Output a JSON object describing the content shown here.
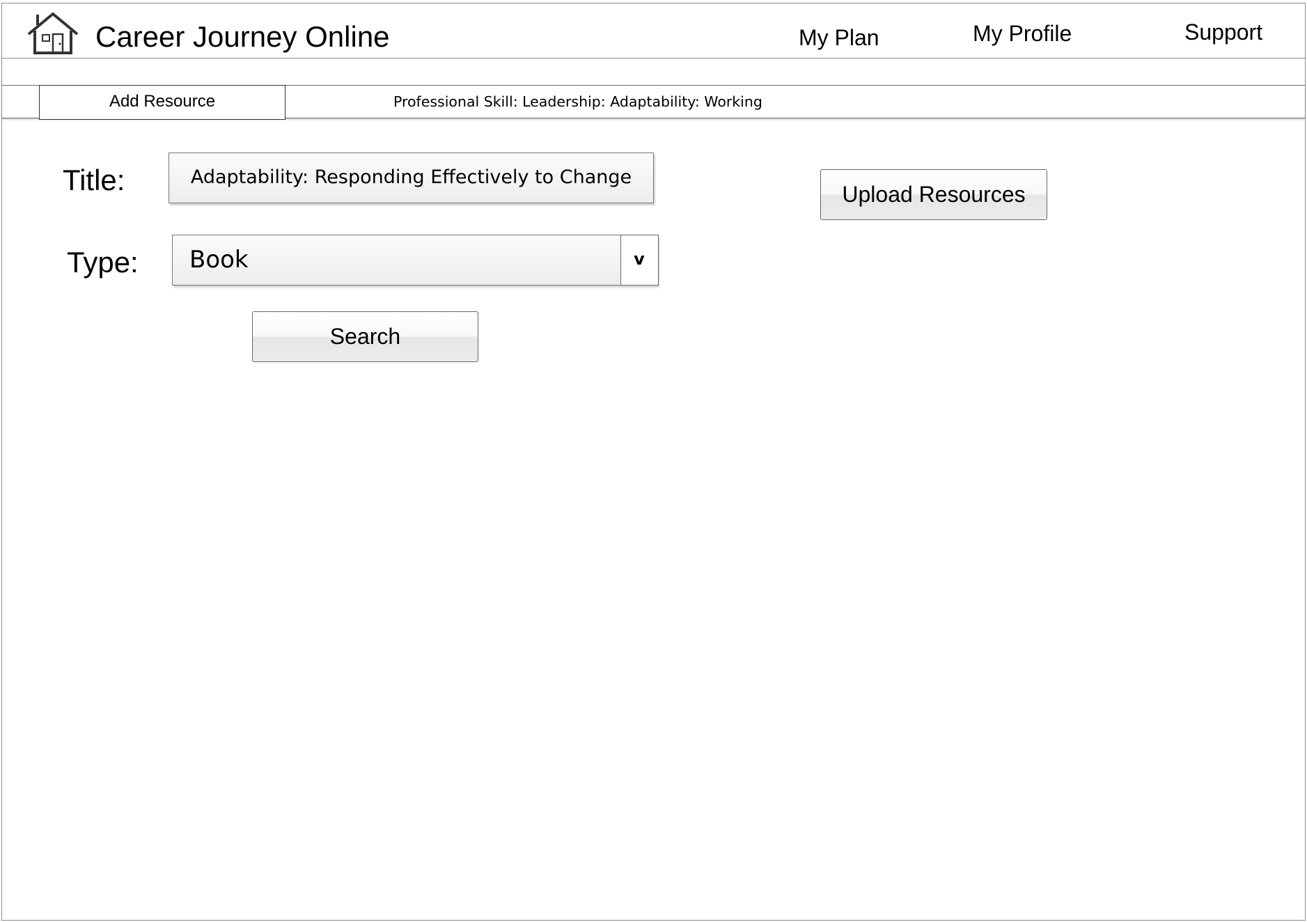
{
  "header": {
    "app_title": "Career Journey Online",
    "nav": {
      "my_plan": "My Plan",
      "my_profile": "My Profile",
      "support": "Support"
    }
  },
  "subbar": {
    "active_tab": "Add Resource",
    "breadcrumb": "Professional Skill: Leadership: Adaptability: Working"
  },
  "form": {
    "title_label": "Title:",
    "title_value": "Adaptability: Responding Effectively to Change",
    "type_label": "Type:",
    "type_value": "Book",
    "dropdown_glyph": "v",
    "search_button": "Search",
    "upload_button": "Upload Resources"
  },
  "colors": {
    "border": "#8a8a8a",
    "icon": "#333333",
    "background": "#ffffff"
  }
}
